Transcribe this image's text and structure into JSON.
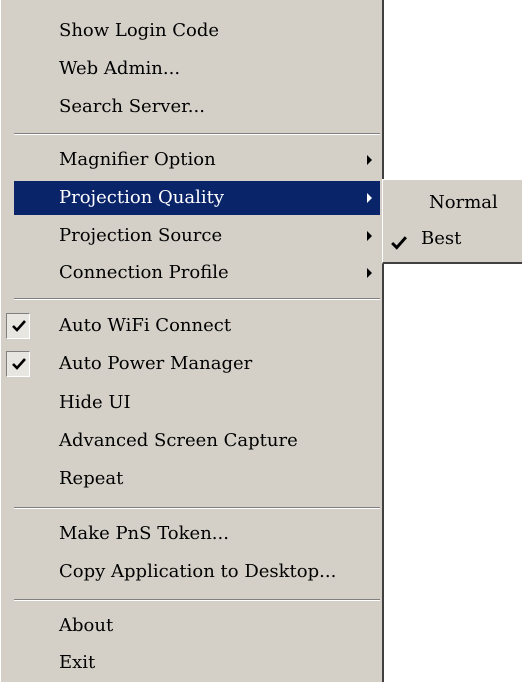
{
  "main_menu": {
    "show_login_code": "Show Login Code",
    "web_admin": "Web Admin...",
    "search_server": "Search Server...",
    "magnifier_option": "Magnifier Option",
    "projection_quality": "Projection Quality",
    "projection_source": "Projection Source",
    "connection_profile": "Connection Profile",
    "auto_wifi_connect": "Auto WiFi Connect",
    "auto_power_manager": "Auto Power Manager",
    "hide_ui": "Hide UI",
    "advanced_screen_capture": "Advanced Screen Capture",
    "repeat": "Repeat",
    "make_pns_token": "Make PnS Token...",
    "copy_application": "Copy Application to Desktop...",
    "about": "About",
    "exit": "Exit"
  },
  "submenu_projection_quality": {
    "normal": "Normal",
    "best": "Best"
  },
  "checked_items": [
    "Auto WiFi Connect",
    "Auto Power Manager",
    "Best"
  ],
  "icons": {
    "submenu_arrow": "chevron-right-icon",
    "check": "check-icon"
  },
  "colors": {
    "menu_background": "#d4d0c8",
    "highlight_background": "#0a246a",
    "highlight_text": "#ffffff"
  }
}
